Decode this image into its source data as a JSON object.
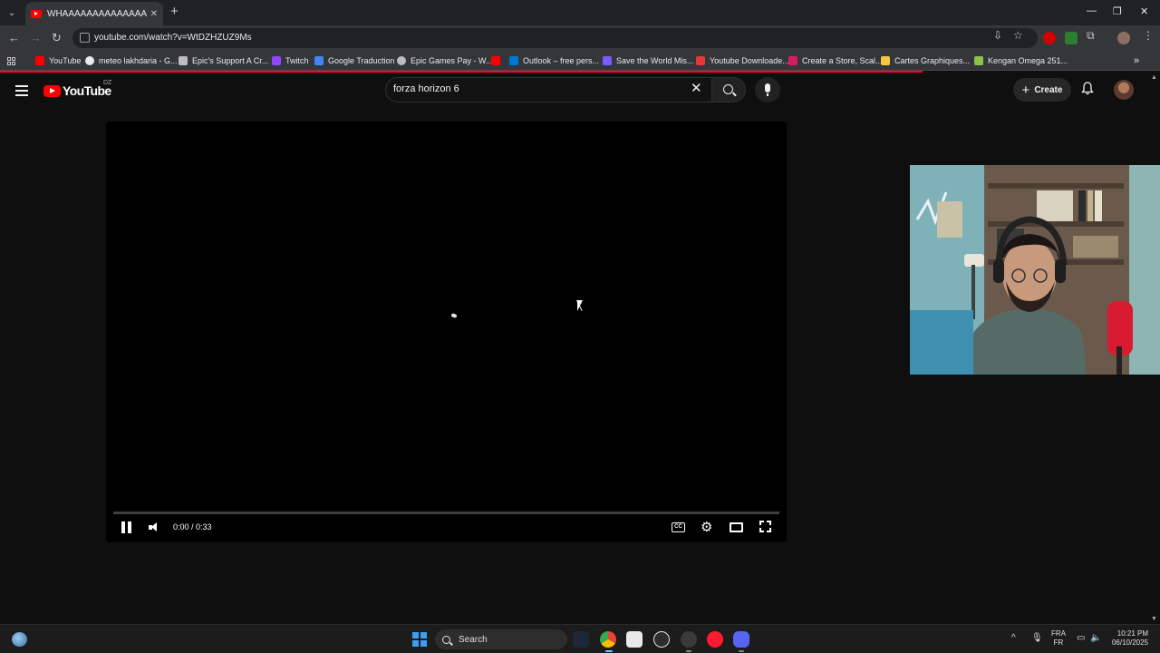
{
  "browser": {
    "tab": {
      "title": "WHAAAAAAAAAAAAAAAAAAAAAAAAAAA",
      "close_glyph": "✕"
    },
    "new_tab_glyph": "+",
    "window_controls": {
      "minimize": "—",
      "restore": "❐",
      "close": "✕"
    },
    "nav": {
      "back": "←",
      "forward": "→",
      "reload": "↻"
    },
    "url": "youtube.com/watch?v=WtDZHZUZ9Ms",
    "bookmarks": [
      {
        "label": "YouTube",
        "color": "#ff0000"
      },
      {
        "label": "meteo lakhdaria - G...",
        "color": "#e8eaed"
      },
      {
        "label": "Epic's Support A Cr...",
        "color": "#bdbdbd"
      },
      {
        "label": "Twitch",
        "color": "#9146ff"
      },
      {
        "label": "Google Traduction",
        "color": "#4285f4"
      },
      {
        "label": "Epic Games Pay - W...",
        "color": "#bdbdbd"
      },
      {
        "label": "",
        "color": "#ff0000"
      },
      {
        "label": "Outlook – free pers...",
        "color": "#0078d4"
      },
      {
        "label": "Save the World Mis...",
        "color": "#7a5cff"
      },
      {
        "label": "Youtube Downloade...",
        "color": "#e53935"
      },
      {
        "label": "Create a Store, Scal...",
        "color": "#d81b60"
      },
      {
        "label": "Cartes Graphiques...",
        "color": "#f4c542"
      },
      {
        "label": "Kengan Omega 251...",
        "color": "#8bc34a"
      }
    ],
    "bookmarks_overflow": "»"
  },
  "youtube": {
    "logo_word": "YouTube",
    "country_code": "DZ",
    "search": {
      "value": "forza horizon 6",
      "clear_glyph": "✕"
    },
    "create_label": "Create",
    "bell_glyph": "🔔"
  },
  "player": {
    "state": "playing",
    "current_time": "0:00",
    "duration": "0:33",
    "time_display": "0:00 / 0:33",
    "progress_fraction": 0.0,
    "cc_label": "CC",
    "settings_glyph": "⚙"
  },
  "taskbar": {
    "search_label": "Search",
    "language_top": "FRA",
    "language_bottom": "FR",
    "time": "10:21 PM",
    "date": "06/10/2025",
    "tray_up_glyph": "^"
  }
}
